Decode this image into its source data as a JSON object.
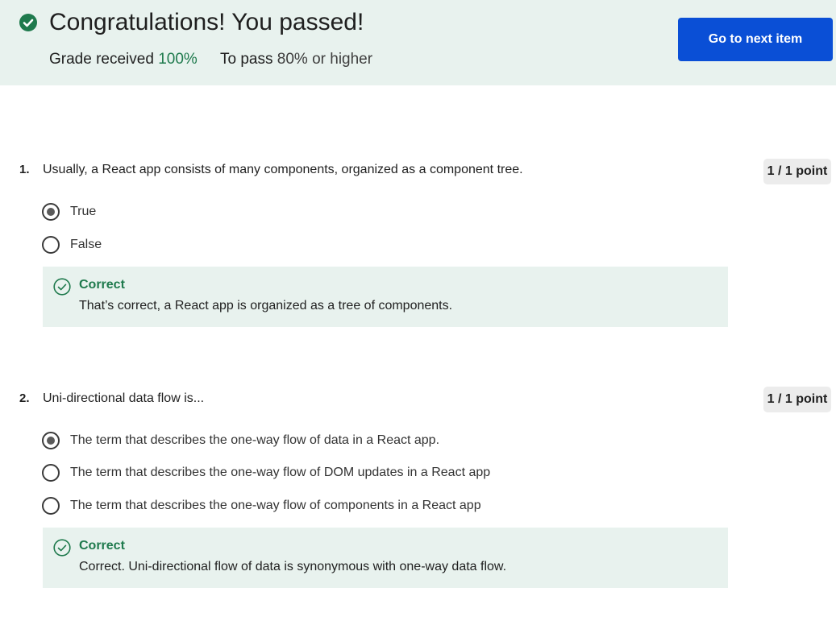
{
  "banner": {
    "title": "Congratulations! You passed!",
    "grade_label": "Grade received",
    "grade_value": "100%",
    "pass_label": "To pass",
    "pass_value": "80% or higher",
    "next_button": "Go to next item"
  },
  "questions": [
    {
      "number": "1.",
      "text": "Usually, a React app consists of many components, organized as a component tree.",
      "points": "1 / 1 point",
      "options": [
        {
          "label": "True",
          "selected": true
        },
        {
          "label": "False",
          "selected": false
        }
      ],
      "feedback": {
        "title": "Correct",
        "text": "That’s correct, a React app is organized as a tree of components."
      }
    },
    {
      "number": "2.",
      "text": "Uni-directional data flow is...",
      "points": "1 / 1 point",
      "options": [
        {
          "label": "The term that describes the one-way flow of data in a React app.",
          "selected": true
        },
        {
          "label": "The term that describes the one-way flow of DOM updates in a React app",
          "selected": false
        },
        {
          "label": "The term that describes the one-way flow of components in a React app",
          "selected": false
        }
      ],
      "feedback": {
        "title": "Correct",
        "text": "Correct. Uni-directional flow of data is synonymous with one-way data flow."
      }
    }
  ],
  "colors": {
    "banner_bg": "#e8f2ee",
    "success_green": "#1f7a4d",
    "button_blue": "#0a4fd6",
    "points_bg": "#ececec"
  },
  "icons": {
    "pass": "check-circle-filled-icon",
    "feedback": "check-circle-outline-icon"
  }
}
